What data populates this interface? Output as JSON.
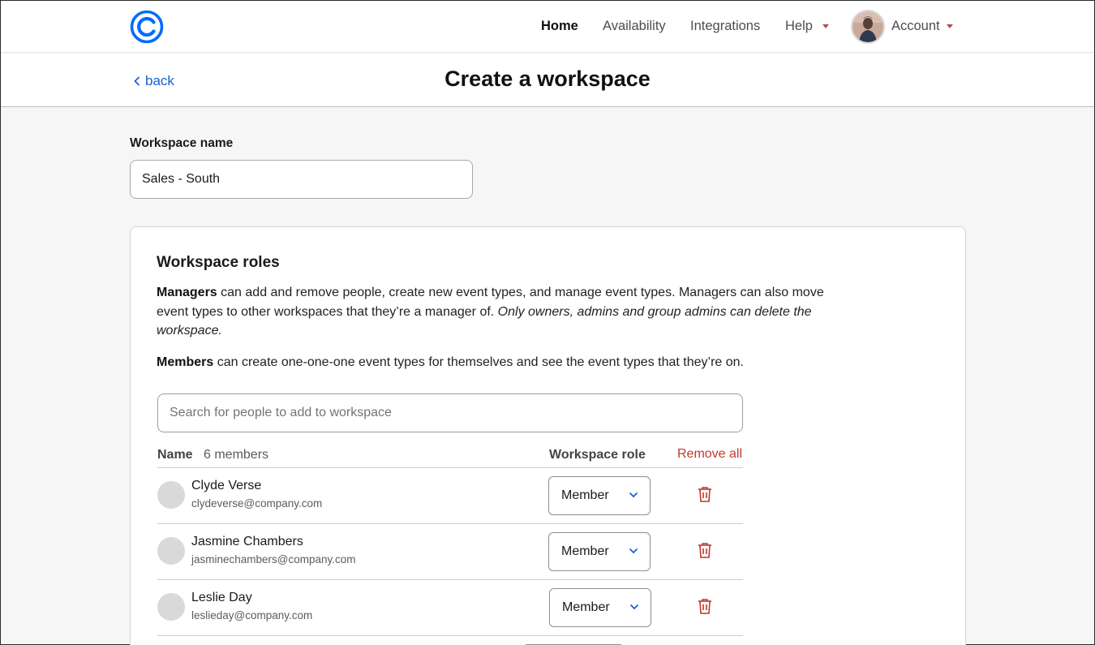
{
  "nav": {
    "links": [
      "Home",
      "Availability",
      "Integrations",
      "Help",
      "Account"
    ],
    "active": "Home"
  },
  "header": {
    "back_label": "back",
    "title": "Create a workspace"
  },
  "form": {
    "workspace_name_label": "Workspace name",
    "workspace_name_value": "Sales - South"
  },
  "roles": {
    "title": "Workspace roles",
    "managers_term": "Managers",
    "managers_text": " can add and remove people, create new event types, and manage event types. Managers can also move event types to other workspaces that they’re a manager of. ",
    "managers_italic": "Only owners, admins and group admins can delete the workspace.",
    "members_term": "Members",
    "members_text": " can create one-one-one event types for themselves and see the event types that they’re on."
  },
  "search": {
    "placeholder": "Search for people to add to workspace"
  },
  "table": {
    "name_header": "Name",
    "count_label": "6 members",
    "role_header": "Workspace role",
    "remove_all": "Remove all",
    "rows": [
      {
        "name": "Clyde Verse",
        "email": "clydeverse@company.com",
        "role": "Member"
      },
      {
        "name": "Jasmine Chambers",
        "email": "jasminechambers@company.com",
        "role": "Member"
      },
      {
        "name": "Leslie Day",
        "email": "leslieday@company.com",
        "role": "Member"
      }
    ]
  },
  "icons": {
    "logo": "calendly-logo",
    "back": "chevron-left-icon",
    "dropdown": "caret-down-icon",
    "select": "chevron-down-icon",
    "delete": "trash-icon"
  },
  "colors": {
    "brand": "#006bff",
    "link": "#1160d6",
    "danger": "#c0392b",
    "caret": "#b64a4a"
  }
}
